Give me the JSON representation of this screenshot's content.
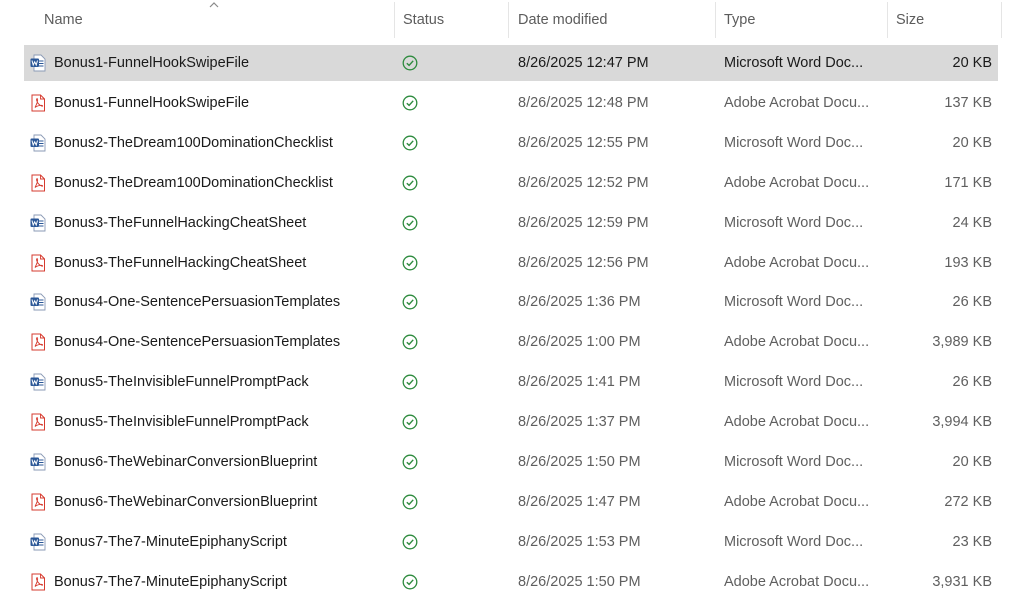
{
  "columns": {
    "name": "Name",
    "status": "Status",
    "date": "Date modified",
    "type": "Type",
    "size": "Size"
  },
  "colors": {
    "selected_row": "#d9d9d9",
    "status_ok": "#2e8b3e",
    "word_blue": "#2b5797",
    "pdf_red": "#d63b2f"
  },
  "files": [
    {
      "name": "Bonus1-FunnelHookSwipeFile",
      "icon": "word-doc-icon",
      "status": "synced-check-icon",
      "date": "8/26/2025 12:47 PM",
      "type": "Microsoft Word Doc...",
      "size": "20 KB",
      "selected": true
    },
    {
      "name": "Bonus1-FunnelHookSwipeFile",
      "icon": "pdf-icon",
      "status": "synced-check-icon",
      "date": "8/26/2025 12:48 PM",
      "type": "Adobe Acrobat Docu...",
      "size": "137 KB"
    },
    {
      "name": "Bonus2-TheDream100DominationChecklist",
      "icon": "word-doc-icon",
      "status": "synced-check-icon",
      "date": "8/26/2025 12:55 PM",
      "type": "Microsoft Word Doc...",
      "size": "20 KB"
    },
    {
      "name": "Bonus2-TheDream100DominationChecklist",
      "icon": "pdf-icon",
      "status": "synced-check-icon",
      "date": "8/26/2025 12:52 PM",
      "type": "Adobe Acrobat Docu...",
      "size": "171 KB"
    },
    {
      "name": "Bonus3-TheFunnelHackingCheatSheet",
      "icon": "word-doc-icon",
      "status": "synced-check-icon",
      "date": "8/26/2025 12:59 PM",
      "type": "Microsoft Word Doc...",
      "size": "24 KB"
    },
    {
      "name": "Bonus3-TheFunnelHackingCheatSheet",
      "icon": "pdf-icon",
      "status": "synced-check-icon",
      "date": "8/26/2025 12:56 PM",
      "type": "Adobe Acrobat Docu...",
      "size": "193 KB"
    },
    {
      "name": "Bonus4-One-SentencePersuasionTemplates",
      "icon": "word-doc-icon",
      "status": "synced-check-icon",
      "date": "8/26/2025 1:36 PM",
      "type": "Microsoft Word Doc...",
      "size": "26 KB"
    },
    {
      "name": "Bonus4-One-SentencePersuasionTemplates",
      "icon": "pdf-icon",
      "status": "synced-check-icon",
      "date": "8/26/2025 1:00 PM",
      "type": "Adobe Acrobat Docu...",
      "size": "3,989 KB"
    },
    {
      "name": "Bonus5-TheInvisibleFunnelPromptPack",
      "icon": "word-doc-icon",
      "status": "synced-check-icon",
      "date": "8/26/2025 1:41 PM",
      "type": "Microsoft Word Doc...",
      "size": "26 KB"
    },
    {
      "name": "Bonus5-TheInvisibleFunnelPromptPack",
      "icon": "pdf-icon",
      "status": "synced-check-icon",
      "date": "8/26/2025 1:37 PM",
      "type": "Adobe Acrobat Docu...",
      "size": "3,994 KB"
    },
    {
      "name": "Bonus6-TheWebinarConversionBlueprint",
      "icon": "word-doc-icon",
      "status": "synced-check-icon",
      "date": "8/26/2025 1:50 PM",
      "type": "Microsoft Word Doc...",
      "size": "20 KB"
    },
    {
      "name": "Bonus6-TheWebinarConversionBlueprint",
      "icon": "pdf-icon",
      "status": "synced-check-icon",
      "date": "8/26/2025 1:47 PM",
      "type": "Adobe Acrobat Docu...",
      "size": "272 KB"
    },
    {
      "name": "Bonus7-The7-MinuteEpiphanyScript",
      "icon": "word-doc-icon",
      "status": "synced-check-icon",
      "date": "8/26/2025 1:53 PM",
      "type": "Microsoft Word Doc...",
      "size": "23 KB"
    },
    {
      "name": "Bonus7-The7-MinuteEpiphanyScript",
      "icon": "pdf-icon",
      "status": "synced-check-icon",
      "date": "8/26/2025 1:50 PM",
      "type": "Adobe Acrobat Docu...",
      "size": "3,931 KB"
    }
  ]
}
